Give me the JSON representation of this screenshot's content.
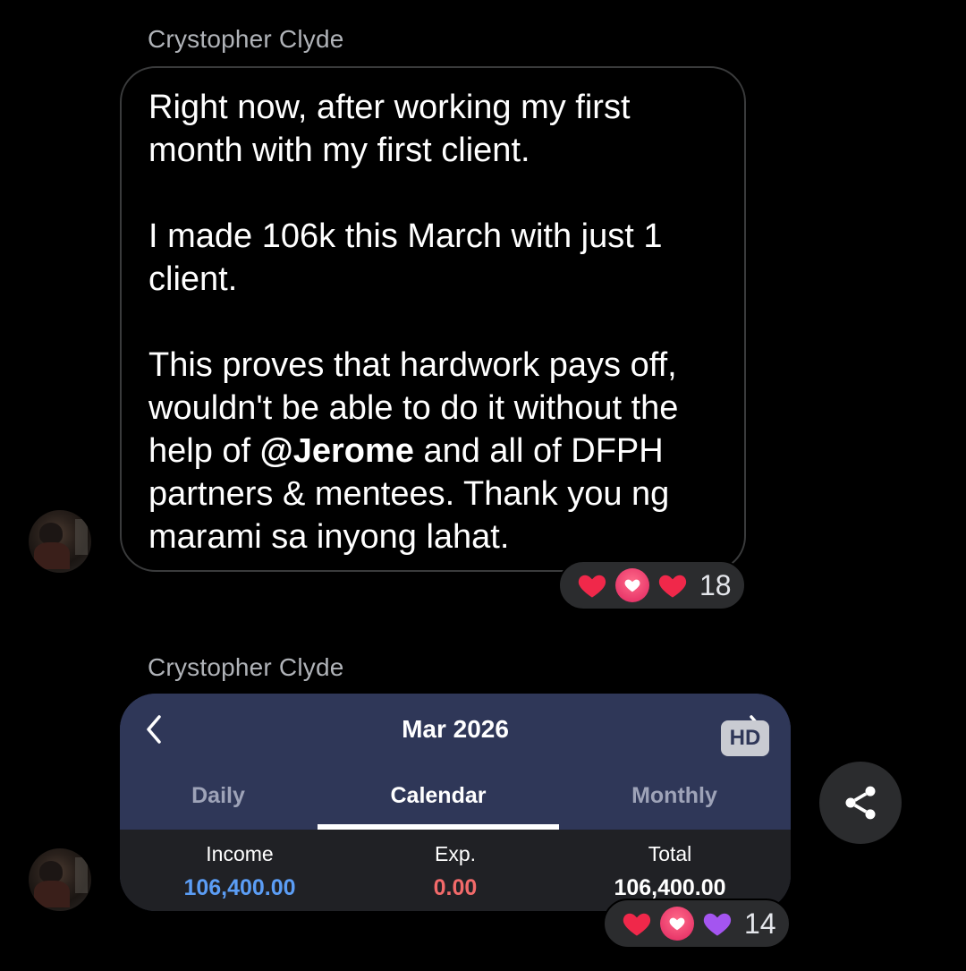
{
  "messages": [
    {
      "sender": "Crystopher Clyde",
      "paragraphs": [
        "Right now, after working my first month with my first client.",
        "I made 106k this March with just 1 client."
      ],
      "p3_before": "This proves that hardwork pays off, wouldn't be able to do it without the help of ",
      "mention": "@Jerome",
      "p3_after": " and all of DFPH partners & mentees. Thank you ng marami sa inyong lahat.",
      "reactions": {
        "icons": [
          "heart-icon",
          "love-icon",
          "heart-icon"
        ],
        "count": "18"
      }
    },
    {
      "sender": "Crystopher Clyde",
      "reactions": {
        "icons": [
          "heart-icon",
          "love-icon",
          "purple-heart-icon"
        ],
        "count": "14"
      }
    }
  ],
  "card": {
    "month": "Mar 2026",
    "hd_badge": "HD",
    "tabs": [
      "Daily",
      "Calendar",
      "Monthly"
    ],
    "active_tab": "Calendar",
    "summary": {
      "income_label": "Income",
      "income_value": "106,400.00",
      "exp_label": "Exp.",
      "exp_value": "0.00",
      "total_label": "Total",
      "total_value": "106,400.00"
    },
    "colors": {
      "header": "#2f3758",
      "income": "#5b9df5",
      "exp": "#f26a6a"
    }
  }
}
